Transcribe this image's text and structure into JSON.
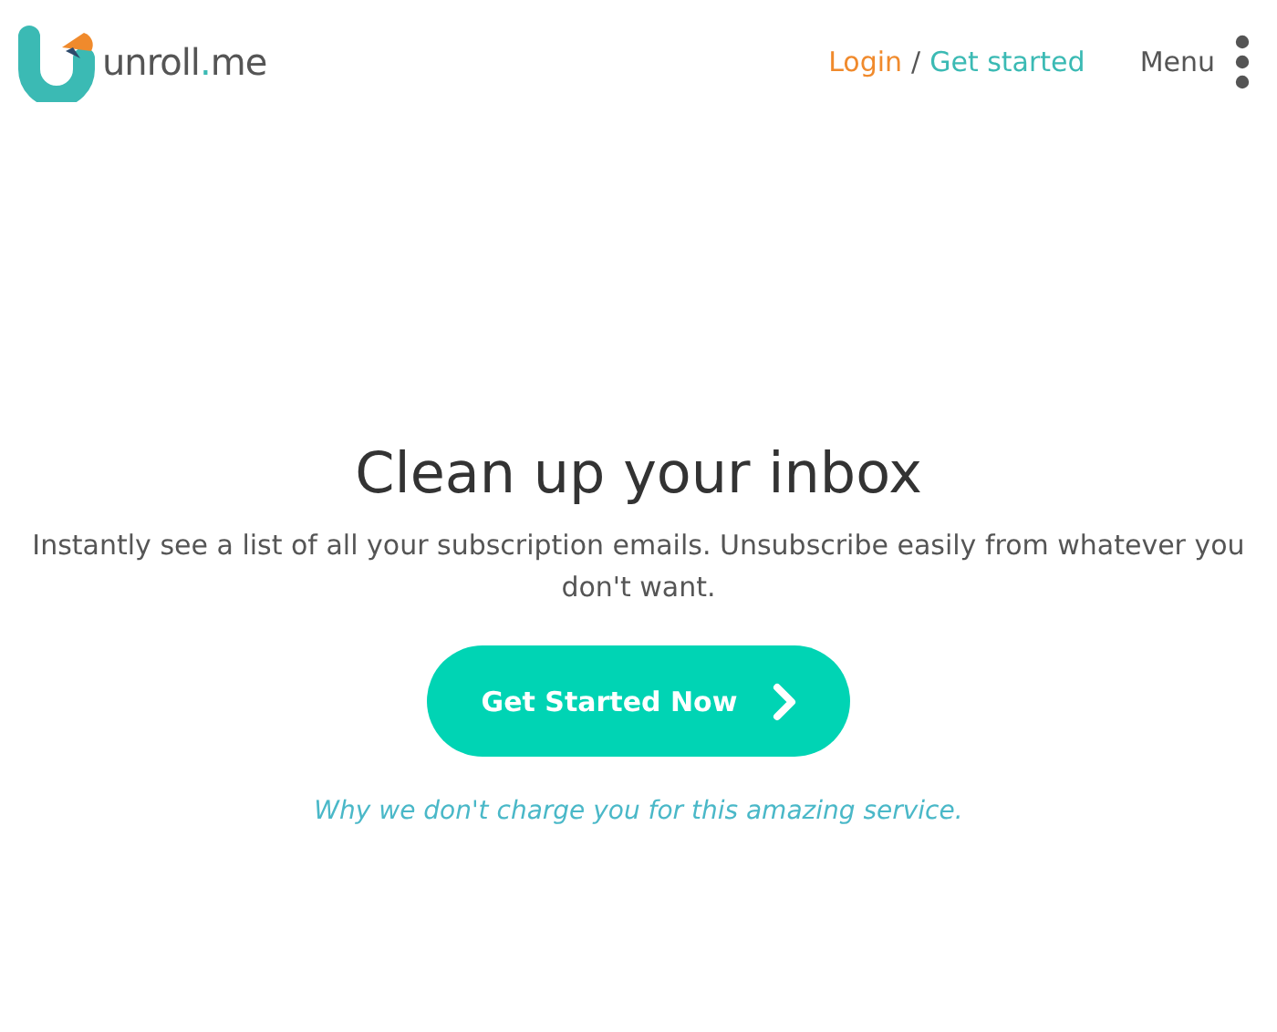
{
  "header": {
    "logo": {
      "parts": [
        "unroll",
        ".",
        "me"
      ]
    },
    "login": "Login",
    "separator": "/",
    "get_started": "Get started",
    "menu": "Menu"
  },
  "hero": {
    "title": "Clean up your inbox",
    "subtitle": "Instantly see a list of all your subscription emails. Unsubscribe easily from whatever you don't want.",
    "cta": "Get Started Now",
    "link": "Why we don't charge you for this amazing service."
  }
}
